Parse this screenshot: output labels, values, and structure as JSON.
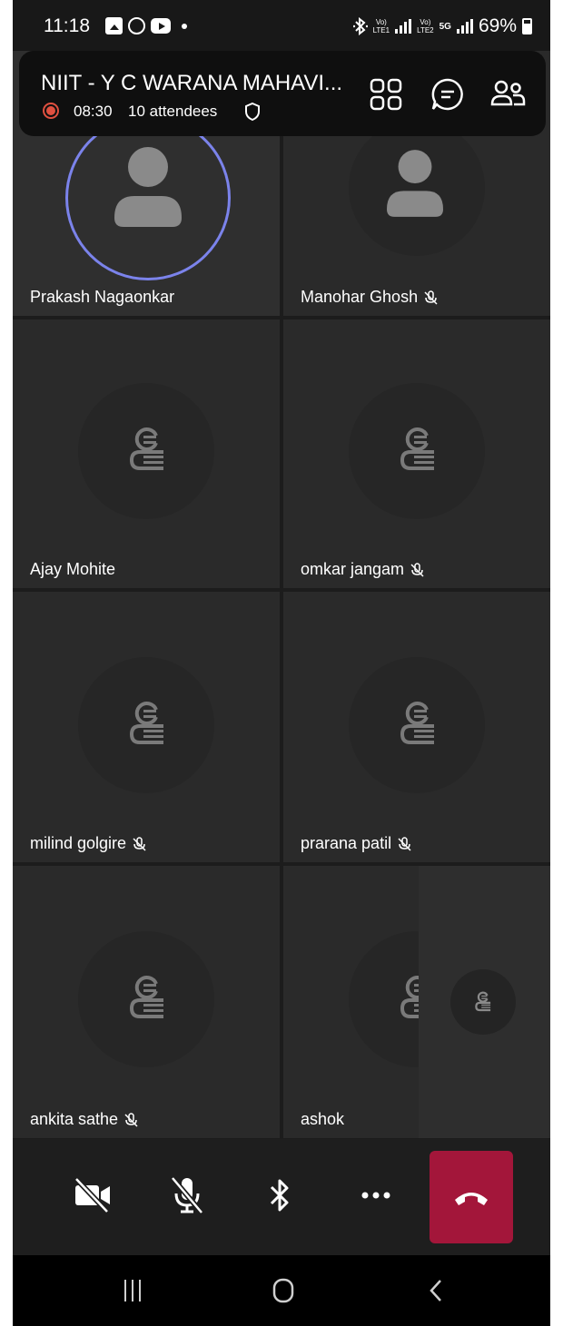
{
  "status_bar": {
    "time": "11:18",
    "battery": "69%",
    "net1": "Vo)",
    "net1_sub": "LTE1",
    "net2": "Vo)",
    "net2_sub": "LTE2",
    "net3": "5G"
  },
  "meeting": {
    "title": "NIIT - Y C WARANA MAHAVI...",
    "duration": "08:30",
    "attendees": "10 attendees"
  },
  "participants": [
    {
      "name": "Prakash Nagaonkar",
      "muted": false,
      "speaking": true
    },
    {
      "name": "Manohar Ghosh",
      "muted": true
    },
    {
      "name": "Ajay Mohite",
      "muted": false
    },
    {
      "name": "omkar jangam",
      "muted": true
    },
    {
      "name": "milind golgire",
      "muted": true
    },
    {
      "name": "prarana patil",
      "muted": true
    },
    {
      "name": "ankita sathe",
      "muted": true
    },
    {
      "name": "ashok",
      "muted": false
    }
  ],
  "colors": {
    "accent_ring": "#7b83eb",
    "end_call": "#a3163a",
    "record": "#e05040"
  },
  "icons": {
    "camera": "camera-off-icon",
    "mic": "mic-off-icon",
    "bluetooth": "bluetooth-icon",
    "more": "more-icon",
    "end_call": "end-call-icon"
  }
}
